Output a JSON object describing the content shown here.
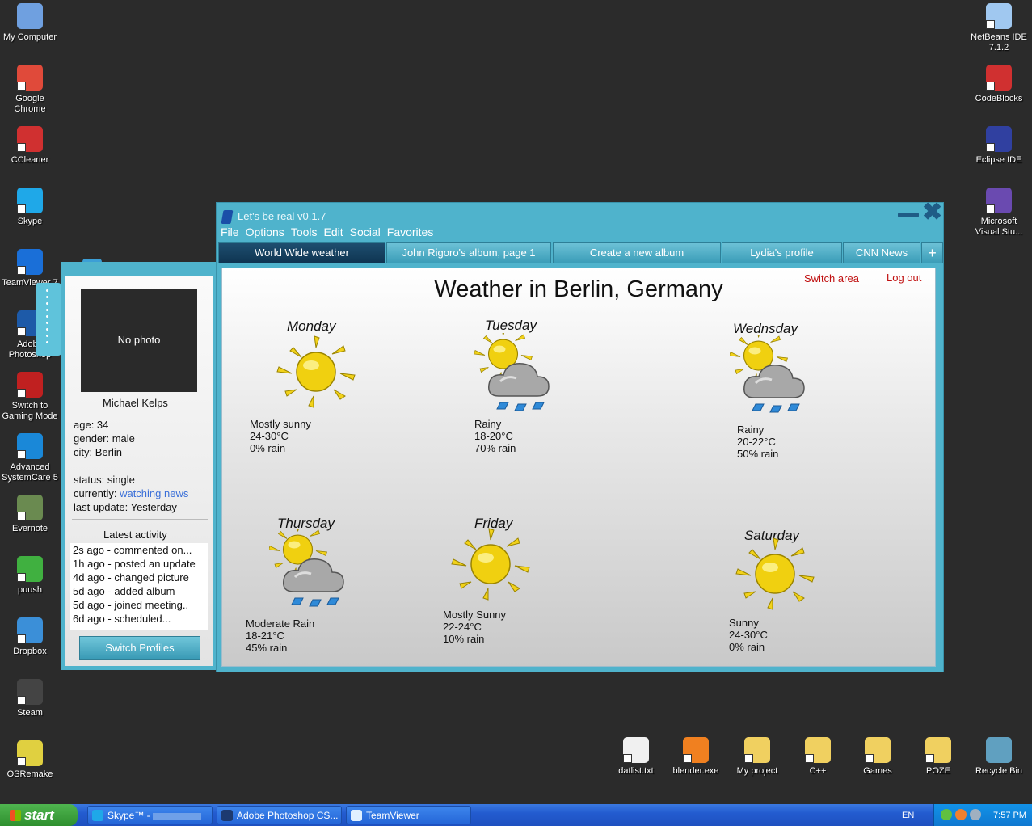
{
  "desktop_left": [
    {
      "label": "My Computer",
      "icon": "computer-icon",
      "color": "#6fa0e0"
    },
    {
      "label": "Google Chrome",
      "icon": "chrome-icon",
      "color": "#e04a3a"
    },
    {
      "label": "CCleaner",
      "icon": "ccleaner-icon",
      "color": "#d03030"
    },
    {
      "label": "Skype",
      "icon": "skype-icon",
      "color": "#1fa8e8"
    },
    {
      "label": "TeamViewer 7",
      "icon": "teamviewer-icon",
      "color": "#1a6fd8"
    },
    {
      "label": "Adobe Photoshop",
      "icon": "photoshop-icon",
      "color": "#1d5aa8"
    },
    {
      "label": "Switch to Gaming Mode",
      "icon": "gaming-mode-icon",
      "color": "#c02020"
    },
    {
      "label": "Advanced SystemCare 5",
      "icon": "systemcare-icon",
      "color": "#1a88d8"
    },
    {
      "label": "Evernote",
      "icon": "evernote-icon",
      "color": "#6a8a50"
    },
    {
      "label": "puush",
      "icon": "puush-icon",
      "color": "#40b040"
    },
    {
      "label": "Dropbox",
      "icon": "dropbox-icon",
      "color": "#3b8fd8"
    },
    {
      "label": "Steam",
      "icon": "steam-icon",
      "color": "#444444"
    },
    {
      "label": "OSRemake",
      "icon": "osremake-icon",
      "color": "#e0d040"
    }
  ],
  "desktop_right": [
    {
      "label": "NetBeans IDE 7.1.2",
      "icon": "netbeans-icon",
      "color": "#a0c8f0"
    },
    {
      "label": "CodeBlocks",
      "icon": "codeblocks-icon",
      "color": "#d03030"
    },
    {
      "label": "Eclipse IDE",
      "icon": "eclipse-icon",
      "color": "#3040a0"
    },
    {
      "label": "Microsoft Visual Stu...",
      "icon": "visual-studio-icon",
      "color": "#6a4ab0"
    }
  ],
  "desktop_bottom": [
    {
      "label": "datlist.txt",
      "icon": "text-file-icon",
      "color": "#f0f0f0"
    },
    {
      "label": "blender.exe",
      "icon": "blender-icon",
      "color": "#f08020"
    },
    {
      "label": "My project",
      "icon": "folder-icon",
      "color": "#f0d060"
    },
    {
      "label": "C++",
      "icon": "folder-icon",
      "color": "#f0d060"
    },
    {
      "label": "Games",
      "icon": "folder-icon",
      "color": "#f0d060"
    },
    {
      "label": "POZE",
      "icon": "folder-icon",
      "color": "#f0d060"
    },
    {
      "label": "Recycle Bin",
      "icon": "recycle-bin-icon",
      "color": "#60a0c0"
    }
  ],
  "app": {
    "title": "Let's be real v0.1.7",
    "menu": [
      "File",
      "Options",
      "Tools",
      "Edit",
      "Social",
      "Favorites"
    ],
    "tabs": [
      "World Wide weather",
      "John Rigoro's album, page 1",
      "Create a new album",
      "Lydia's profile",
      "CNN News",
      "+"
    ],
    "weather_title": "Weather in Berlin, Germany",
    "switch_area": "Switch area",
    "logout": "Log out",
    "days": [
      {
        "day": "Monday",
        "cond": "Mostly sunny",
        "temp": "24-30°C",
        "rain": "0% rain"
      },
      {
        "day": "Tuesday",
        "cond": "Rainy",
        "temp": "18-20°C",
        "rain": "70% rain"
      },
      {
        "day": "Wednsday",
        "cond": "Rainy",
        "temp": "20-22°C",
        "rain": "50% rain"
      },
      {
        "day": "Thursday",
        "cond": "Moderate Rain",
        "temp": "18-21°C",
        "rain": "45% rain"
      },
      {
        "day": "Friday",
        "cond": "Mostly Sunny",
        "temp": "22-24°C",
        "rain": "10% rain"
      },
      {
        "day": "Saturday",
        "cond": "Sunny",
        "temp": "24-30°C",
        "rain": "0% rain"
      }
    ]
  },
  "profile": {
    "photo": "No photo",
    "name": "Michael Kelps",
    "age": "age: 34",
    "gender": "gender: male",
    "city": "city: Berlin",
    "status": "status: single",
    "currently_label": "currently: ",
    "currently_value": "watching news",
    "last_update": "last update: Yesterday",
    "latest_activity": "Latest activity",
    "activity": [
      "2s ago - commented on...",
      "1h ago - posted an update",
      "4d ago - changed picture",
      "5d ago - added album",
      "5d ago - joined meeting..",
      "6d ago - scheduled..."
    ],
    "switch_profiles": "Switch Profiles"
  },
  "taskbar": {
    "start": "start",
    "tasks": [
      "Skype™ - ",
      "Adobe Photoshop CS...",
      "TeamViewer"
    ],
    "lang": "EN",
    "clock": "7:57 PM"
  }
}
